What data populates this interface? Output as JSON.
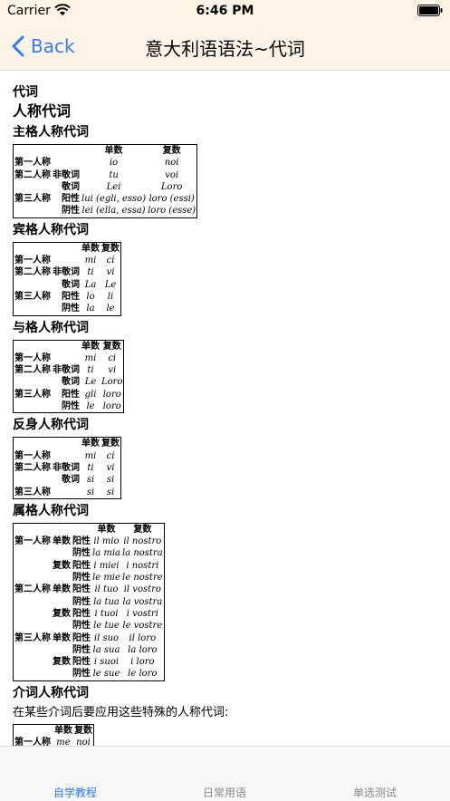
{
  "status": {
    "carrier": "Carrier",
    "time": "6:46 PM"
  },
  "nav": {
    "back_label": "Back",
    "title": "意大利语语法~代词"
  },
  "content": {
    "section_title": "代词",
    "main_title": "人称代词",
    "tables": [
      {
        "title": "主格人称代词",
        "headers": [
          "单数",
          "复数"
        ],
        "rows": [
          [
            "第一人称",
            "",
            "io",
            "noi"
          ],
          [
            "第二人称",
            "非敬词",
            "tu",
            "voi"
          ],
          [
            "",
            "敬词",
            "Lei",
            "Loro"
          ],
          [
            "第三人称",
            "阳性",
            "lui (egli, esso)",
            "loro (essi)"
          ],
          [
            "",
            "阴性",
            "lei (ella, essa)",
            "loro (esse)"
          ]
        ]
      },
      {
        "title": "宾格人称代词",
        "headers": [
          "单数",
          "复数"
        ],
        "rows": [
          [
            "第一人称",
            "",
            "mi",
            "ci"
          ],
          [
            "第二人称",
            "非敬词",
            "ti",
            "vi"
          ],
          [
            "",
            "敬词",
            "La",
            "Le"
          ],
          [
            "第三人称",
            "阳性",
            "lo",
            "li"
          ],
          [
            "",
            "阴性",
            "la",
            "le"
          ]
        ]
      },
      {
        "title": "与格人称代词",
        "headers": [
          "单数",
          "复数"
        ],
        "rows": [
          [
            "第一人称",
            "",
            "mi",
            "ci"
          ],
          [
            "第二人称",
            "非敬词",
            "ti",
            "vi"
          ],
          [
            "",
            "敬词",
            "Le",
            "Loro"
          ],
          [
            "第三人称",
            "阳性",
            "gli",
            "loro"
          ],
          [
            "",
            "阴性",
            "le",
            "loro"
          ]
        ]
      },
      {
        "title": "反身人称代词",
        "headers": [
          "单数",
          "复数"
        ],
        "rows": [
          [
            "第一人称",
            "",
            "mi",
            "ci"
          ],
          [
            "第二人称",
            "非敬词",
            "ti",
            "vi"
          ],
          [
            "",
            "敬词",
            "si",
            "si"
          ],
          [
            "第三人称",
            "",
            "si",
            "si"
          ]
        ]
      }
    ],
    "possessive": {
      "title": "属格人称代词",
      "headers": [
        "单数",
        "复数"
      ],
      "rows": [
        [
          "第一人称",
          "单数",
          "阳性",
          "il mio",
          "il nostro"
        ],
        [
          "",
          "",
          "阴性",
          "la mia",
          "la nostra"
        ],
        [
          "",
          "复数",
          "阳性",
          "i miei",
          "i nostri"
        ],
        [
          "",
          "",
          "阴性",
          "le mie",
          "le nostre"
        ],
        [
          "第二人称",
          "单数",
          "阳性",
          "il tuo",
          "il vostro"
        ],
        [
          "",
          "",
          "阴性",
          "la tua",
          "la vostra"
        ],
        [
          "",
          "复数",
          "阳性",
          "i tuoi",
          "i vostri"
        ],
        [
          "",
          "",
          "阴性",
          "le tue",
          "le vostre"
        ],
        [
          "第三人称",
          "单数",
          "阳性",
          "il suo",
          "il loro"
        ],
        [
          "",
          "",
          "阴性",
          "la sua",
          "la loro"
        ],
        [
          "",
          "复数",
          "阳性",
          "i suoi",
          "i loro"
        ],
        [
          "",
          "",
          "阴性",
          "le sue",
          "le loro"
        ]
      ]
    },
    "prepositional": {
      "title": "介词人称代词",
      "description": "在某些介词后要应用这些特殊的人称代词:",
      "headers": [
        "单数",
        "复数"
      ],
      "rows": [
        [
          "第一人称",
          "",
          "me",
          "noi"
        ]
      ]
    }
  },
  "tabs": [
    {
      "label": "自学教程",
      "active": true
    },
    {
      "label": "日常用语",
      "active": false
    },
    {
      "label": "单选测试",
      "active": false
    }
  ],
  "colors": {
    "accent": "#2f7cf6",
    "header_bg": "#fdf3e6"
  }
}
